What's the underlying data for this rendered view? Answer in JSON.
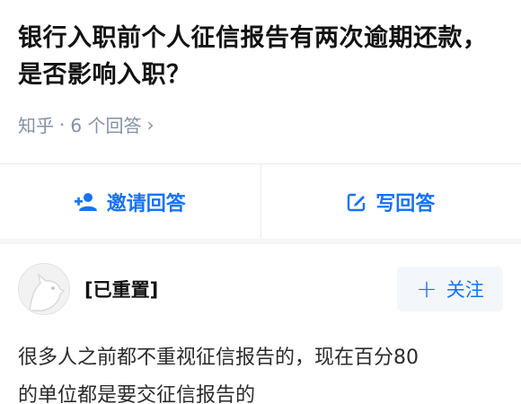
{
  "question": {
    "title": "银行入职前个人征信报告有两次逾期还款，是否影响入职？",
    "source": "知乎",
    "separator": "·",
    "answer_count": "6 个回答",
    "chevron": "›"
  },
  "actions": {
    "invite_label": "邀请回答",
    "write_label": "写回答",
    "invite_icon": "add-user-icon",
    "write_icon": "edit-icon",
    "accent": "#1772f6"
  },
  "answer": {
    "author": "[已重置]",
    "follow_label": "关注",
    "follow_plus": "+",
    "text_line1": "很多人之前都不重视征信报告的，现在百分80",
    "text_line2": "的单位都是要交征信报告的"
  }
}
